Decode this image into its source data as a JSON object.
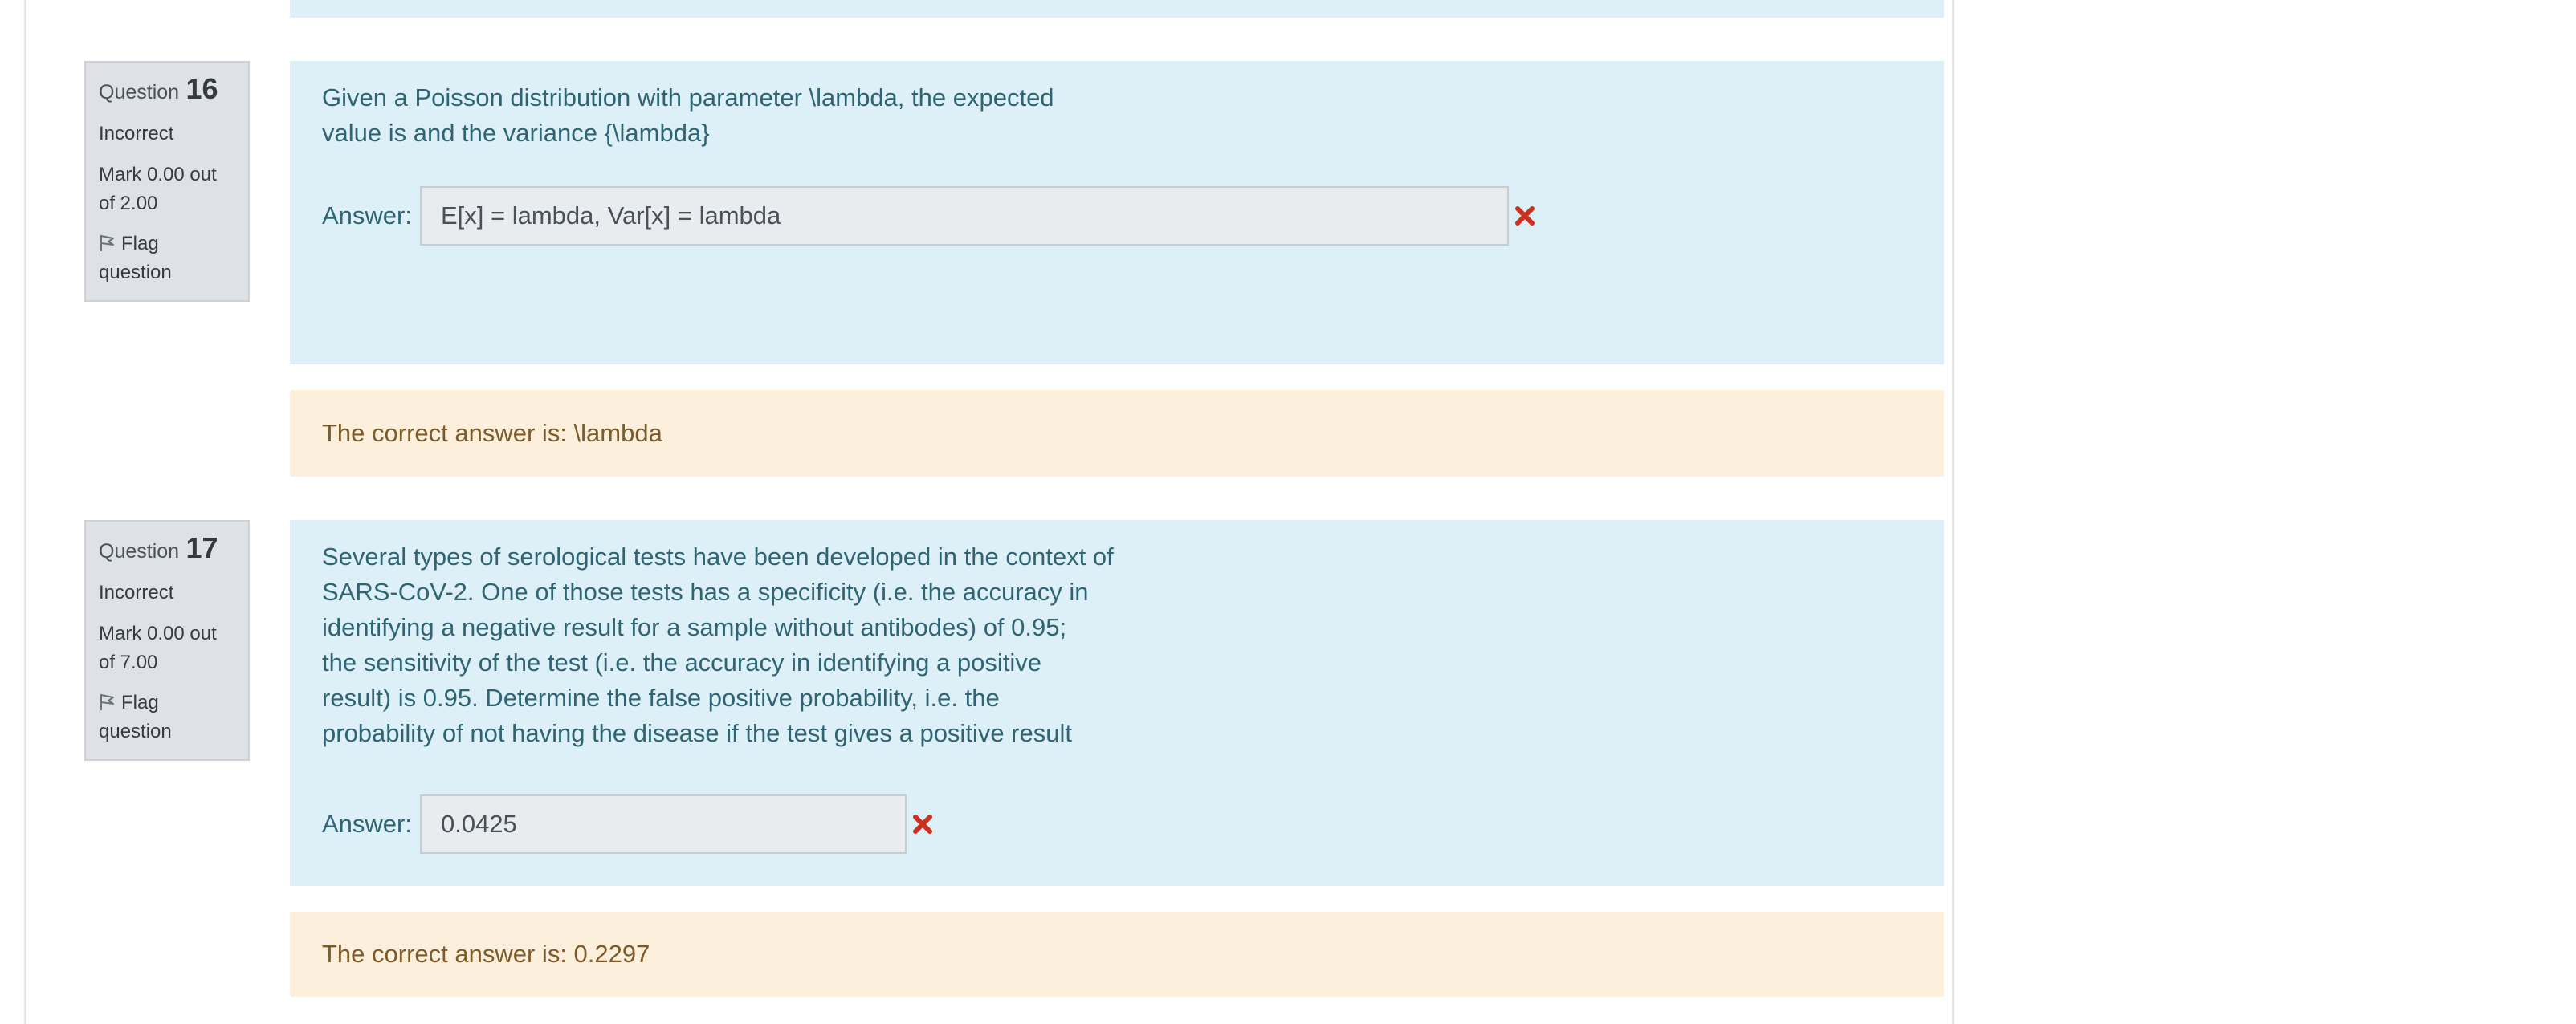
{
  "questions": [
    {
      "label": "Question",
      "number": "16",
      "state": "Incorrect",
      "grade_line1": "Mark 0.00 out",
      "grade_line2": "of 2.00",
      "flag_line1": "Flag",
      "flag_line2": "question",
      "text_lines": [
        "Given a Poisson distribution with parameter \\lambda, the expected",
        "value is and the variance {\\lambda}"
      ],
      "answer_label": "Answer:",
      "answer_value": "E[x] = lambda, Var[x] = lambda",
      "feedback": "The correct answer is: \\lambda"
    },
    {
      "label": "Question",
      "number": "17",
      "state": "Incorrect",
      "grade_line1": "Mark 0.00 out",
      "grade_line2": "of 7.00",
      "flag_line1": "Flag",
      "flag_line2": "question",
      "text_lines": [
        "Several types of serological tests have been developed in the context of",
        "SARS-CoV-2. One of those tests has a specificity (i.e. the accuracy in",
        "identifying a negative result for a sample without antibodes) of 0.95;",
        "the sensitivity of the test (i.e. the accuracy in identifying a positive",
        "result) is 0.95. Determine the false positive probability, i.e. the",
        "probability of not having the disease if the test gives a positive result"
      ],
      "answer_label": "Answer:",
      "answer_value": "0.0425",
      "feedback": "The correct answer is: 0.2297"
    }
  ],
  "icons": {
    "flag": "flag-icon",
    "incorrect": "incorrect-x-icon"
  },
  "colors": {
    "formulation_bg": "#def0f7",
    "feedback_bg": "#fcefdc",
    "info_bg": "#dee2e6",
    "incorrect_mark": "#ca3120"
  }
}
